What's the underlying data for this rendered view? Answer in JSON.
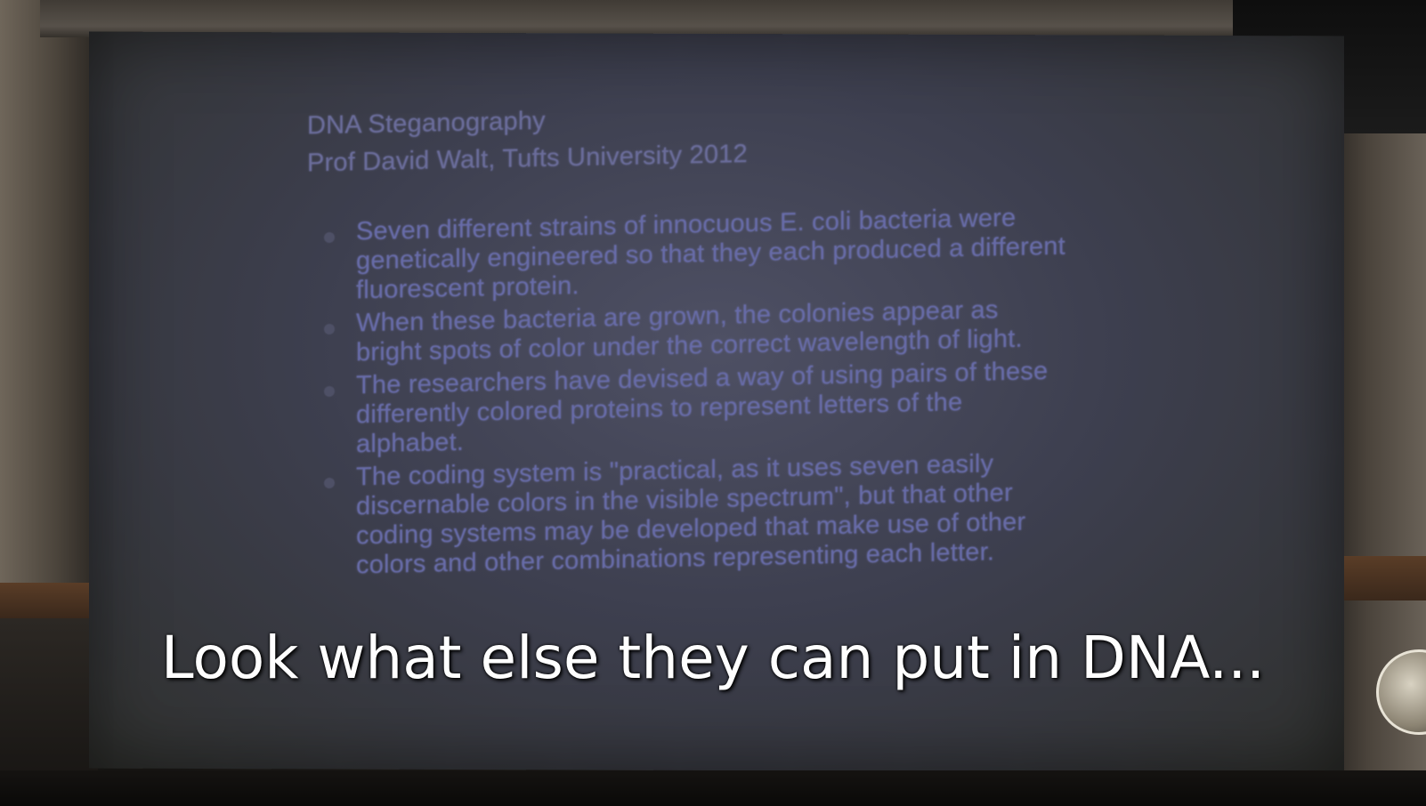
{
  "slide": {
    "title_line1": "DNA Steganography",
    "title_line2": "Prof David Walt, Tufts University 2012",
    "bullets": [
      "Seven different strains of innocuous E. coli bacteria were genetically engineered so that they each produced a different fluorescent protein.",
      "When these bacteria are grown, the colonies appear as bright spots of color under the correct wavelength of light.",
      "The researchers have devised a way of using pairs of these differently colored proteins to represent letters of the alphabet.",
      "The coding system is \"practical, as it uses seven easily discernable colors in the visible spectrum\", but that other coding systems may be developed that make use of other colors and other combinations representing each letter."
    ]
  },
  "caption": "Look what else they can put in DNA..."
}
